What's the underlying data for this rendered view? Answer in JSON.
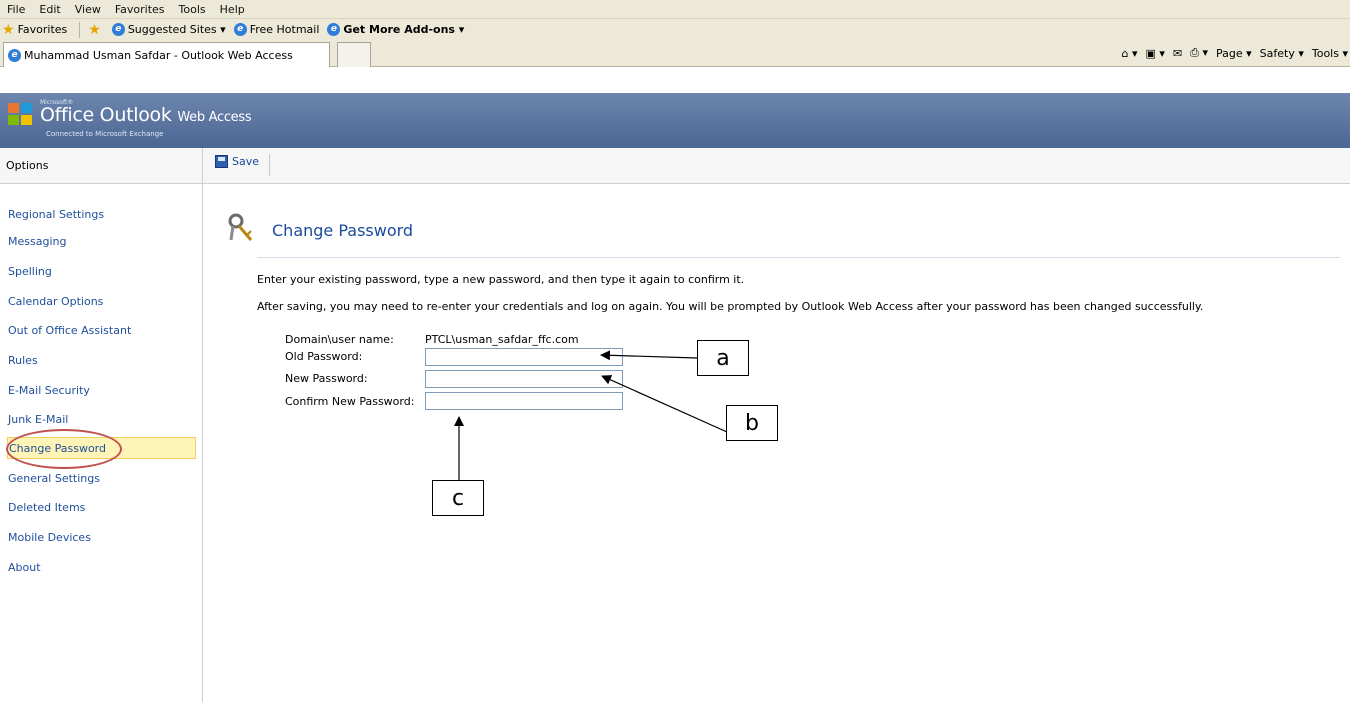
{
  "browser": {
    "menu": [
      "File",
      "Edit",
      "View",
      "Favorites",
      "Tools",
      "Help"
    ],
    "favorites_label": "Favorites",
    "fav_links": [
      "Suggested Sites ▾",
      "Free Hotmail",
      "Get More Add-ons ▾"
    ],
    "tab_title": "Muhammad Usman Safdar - Outlook Web Access",
    "commands": [
      "Page ▾",
      "Safety ▾",
      "Tools ▾"
    ]
  },
  "owa": {
    "microsoft": "Microsoft®",
    "title": "Office Outlook",
    "title_suffix": "Web Access",
    "subtitle": "Connected to Microsoft Exchange"
  },
  "sidebar": {
    "header": "Options",
    "items": [
      "Regional Settings",
      "Messaging",
      "Spelling",
      "Calendar Options",
      "Out of Office Assistant",
      "Rules",
      "E-Mail Security",
      "Junk E-Mail",
      "Change Password",
      "General Settings",
      "Deleted Items",
      "Mobile Devices",
      "About"
    ],
    "active": "Change Password"
  },
  "toolbar": {
    "save_label": "Save"
  },
  "content": {
    "title": "Change Password",
    "intro1": "Enter your existing password, type a new password, and then type it again to confirm it.",
    "intro2": "After saving, you may need to re-enter your credentials and log on again. You will be prompted by Outlook Web Access after your password has been changed successfully.",
    "domain_label": "Domain\\user name:",
    "domain_value": "PTCL\\usman_safdar_ffc.com",
    "old_label": "Old Password:",
    "new_label": "New Password:",
    "confirm_label": "Confirm New Password:",
    "old_value": "",
    "new_value": "",
    "confirm_value": ""
  },
  "annotations": {
    "a": "a",
    "b": "b",
    "c": "c"
  },
  "colors": {
    "accent": "#1a4a9c",
    "active_bg": "#fff4b8",
    "circle": "#c0504d",
    "header": "#5a739f"
  }
}
